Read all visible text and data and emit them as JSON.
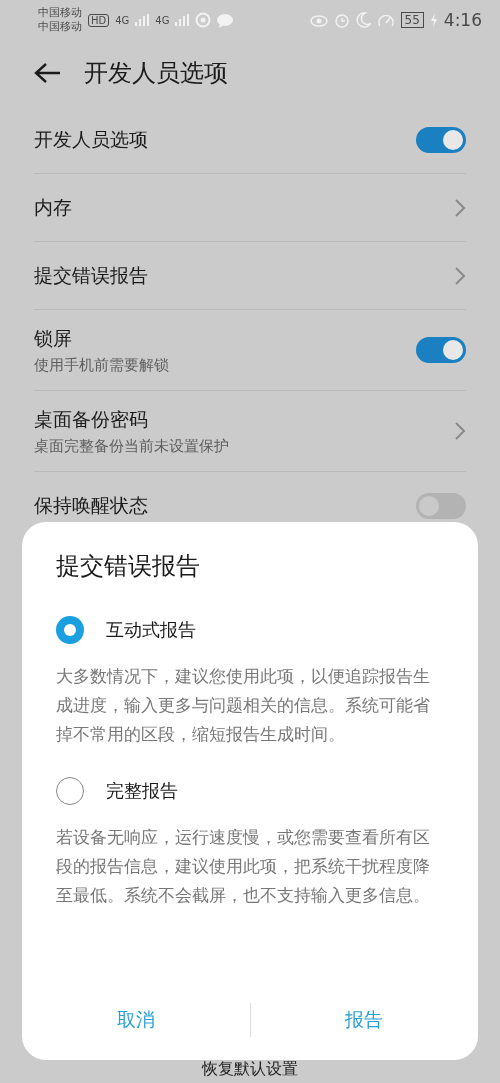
{
  "status_bar": {
    "carriers": [
      "中国移动",
      "中国移动"
    ],
    "hd_badge": "HD",
    "networks": [
      "4G",
      "4G"
    ],
    "battery": "55",
    "time": "4:16"
  },
  "header": {
    "title": "开发人员选项"
  },
  "settings": [
    {
      "kind": "toggle",
      "title": "开发人员选项",
      "on": true
    },
    {
      "kind": "link",
      "title": "内存"
    },
    {
      "kind": "link",
      "title": "提交错误报告"
    },
    {
      "kind": "toggle",
      "title": "锁屏",
      "subtitle": "使用手机前需要解锁",
      "on": true
    },
    {
      "kind": "link",
      "title": "桌面备份密码",
      "subtitle": "桌面完整备份当前未设置保护"
    },
    {
      "kind": "toggle",
      "title": "保持唤醒状态",
      "on": false
    }
  ],
  "dialog": {
    "title": "提交错误报告",
    "options": [
      {
        "label": "互动式报告",
        "selected": true,
        "description": "大多数情况下，建议您使用此项，以便追踪报告生成进度，输入更多与问题相关的信息。系统可能省掉不常用的区段，缩短报告生成时间。"
      },
      {
        "label": "完整报告",
        "selected": false,
        "description": "若设备无响应，运行速度慢，或您需要查看所有区段的报告信息，建议使用此项，把系统干扰程度降至最低。系统不会截屏，也不支持输入更多信息。"
      }
    ],
    "buttons": [
      "取消",
      "报告"
    ]
  },
  "footer": {
    "label": "恢复默认设置"
  }
}
